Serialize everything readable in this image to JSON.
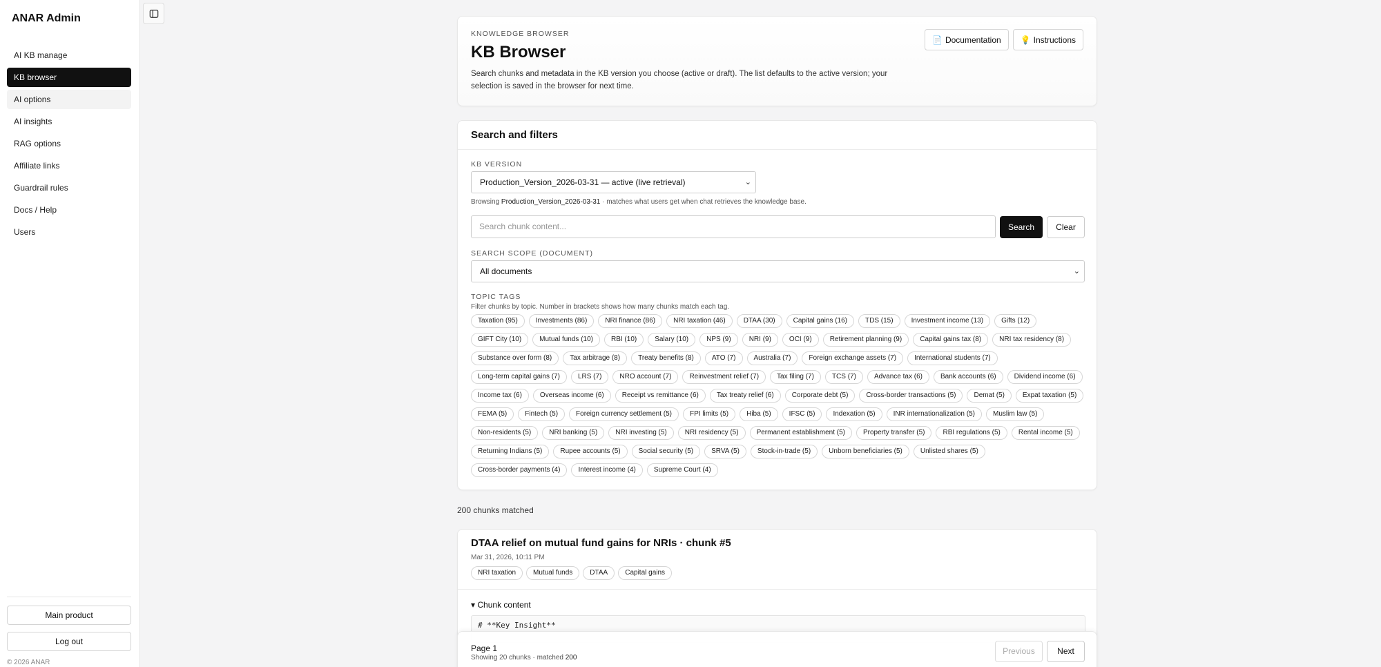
{
  "sidebar": {
    "brand": "ANAR Admin",
    "items": [
      {
        "label": "AI KB manage"
      },
      {
        "label": "KB browser"
      },
      {
        "label": "AI options"
      },
      {
        "label": "AI insights"
      },
      {
        "label": "RAG options"
      },
      {
        "label": "Affiliate links"
      },
      {
        "label": "Guardrail rules"
      },
      {
        "label": "Docs / Help"
      },
      {
        "label": "Users"
      }
    ],
    "main_product_label": "Main product",
    "logout_label": "Log out",
    "copyright": "© 2026 ANAR"
  },
  "header": {
    "eyebrow": "KNOWLEDGE BROWSER",
    "title": "KB Browser",
    "description": "Search chunks and metadata in the KB version you choose (active or draft). The list defaults to the active version; your selection is saved in the browser for next time.",
    "documentation_label": "Documentation",
    "instructions_label": "Instructions"
  },
  "filters": {
    "title": "Search and filters",
    "kb_version_label": "KB VERSION",
    "kb_version_value": "Production_Version_2026-03-31 — active (live retrieval)",
    "browsing_prefix": "Browsing",
    "browsing_version": "Production_Version_2026-03-31",
    "browsing_suffix": "· matches what users get when chat retrieves the knowledge base.",
    "search_placeholder": "Search chunk content...",
    "search_label": "Search",
    "clear_label": "Clear",
    "scope_label": "SEARCH SCOPE (DOCUMENT)",
    "scope_value": "All documents",
    "topic_label": "TOPIC TAGS",
    "topic_hint": "Filter chunks by topic. Number in brackets shows how many chunks match each tag.",
    "tags": [
      "Taxation (95)",
      "Investments (86)",
      "NRI finance (86)",
      "NRI taxation (46)",
      "DTAA (30)",
      "Capital gains (16)",
      "TDS (15)",
      "Investment income (13)",
      "Gifts (12)",
      "GIFT City (10)",
      "Mutual funds (10)",
      "RBI (10)",
      "Salary (10)",
      "NPS (9)",
      "NRI (9)",
      "OCI (9)",
      "Retirement planning (9)",
      "Capital gains tax (8)",
      "NRI tax residency (8)",
      "Substance over form (8)",
      "Tax arbitrage (8)",
      "Treaty benefits (8)",
      "ATO (7)",
      "Australia (7)",
      "Foreign exchange assets (7)",
      "International students (7)",
      "Long-term capital gains (7)",
      "LRS (7)",
      "NRO account (7)",
      "Reinvestment relief (7)",
      "Tax filing (7)",
      "TCS (7)",
      "Advance tax (6)",
      "Bank accounts (6)",
      "Dividend income (6)",
      "Income tax (6)",
      "Overseas income (6)",
      "Receipt vs remittance (6)",
      "Tax treaty relief (6)",
      "Corporate debt (5)",
      "Cross-border transactions (5)",
      "Demat (5)",
      "Expat taxation (5)",
      "FEMA (5)",
      "Fintech (5)",
      "Foreign currency settlement (5)",
      "FPI limits (5)",
      "Hiba (5)",
      "IFSC (5)",
      "Indexation (5)",
      "INR internationalization (5)",
      "Muslim law (5)",
      "Non-residents (5)",
      "NRI banking (5)",
      "NRI investing (5)",
      "NRI residency (5)",
      "Permanent establishment (5)",
      "Property transfer (5)",
      "RBI regulations (5)",
      "Rental income (5)",
      "Returning Indians (5)",
      "Rupee accounts (5)",
      "Social security (5)",
      "SRVA (5)",
      "Stock-in-trade (5)",
      "Unborn beneficiaries (5)",
      "Unlisted shares (5)",
      "Cross-border payments (4)",
      "Interest income (4)",
      "Supreme Court (4)"
    ]
  },
  "results": {
    "count_text": "200 chunks matched",
    "items": [
      {
        "title": "DTAA relief on mutual fund gains for NRIs · chunk #5",
        "date": "Mar 31, 2026, 10:11 PM",
        "tags": [
          "NRI taxation",
          "Mutual funds",
          "DTAA",
          "Capital gains"
        ],
        "details_label": "Chunk content",
        "content_preview": "# **Key Insight**"
      }
    ]
  },
  "pager": {
    "page_label": "Page 1",
    "showing_text": "Showing 20 chunks · matched",
    "matched": "200",
    "previous_label": "Previous",
    "next_label": "Next"
  }
}
